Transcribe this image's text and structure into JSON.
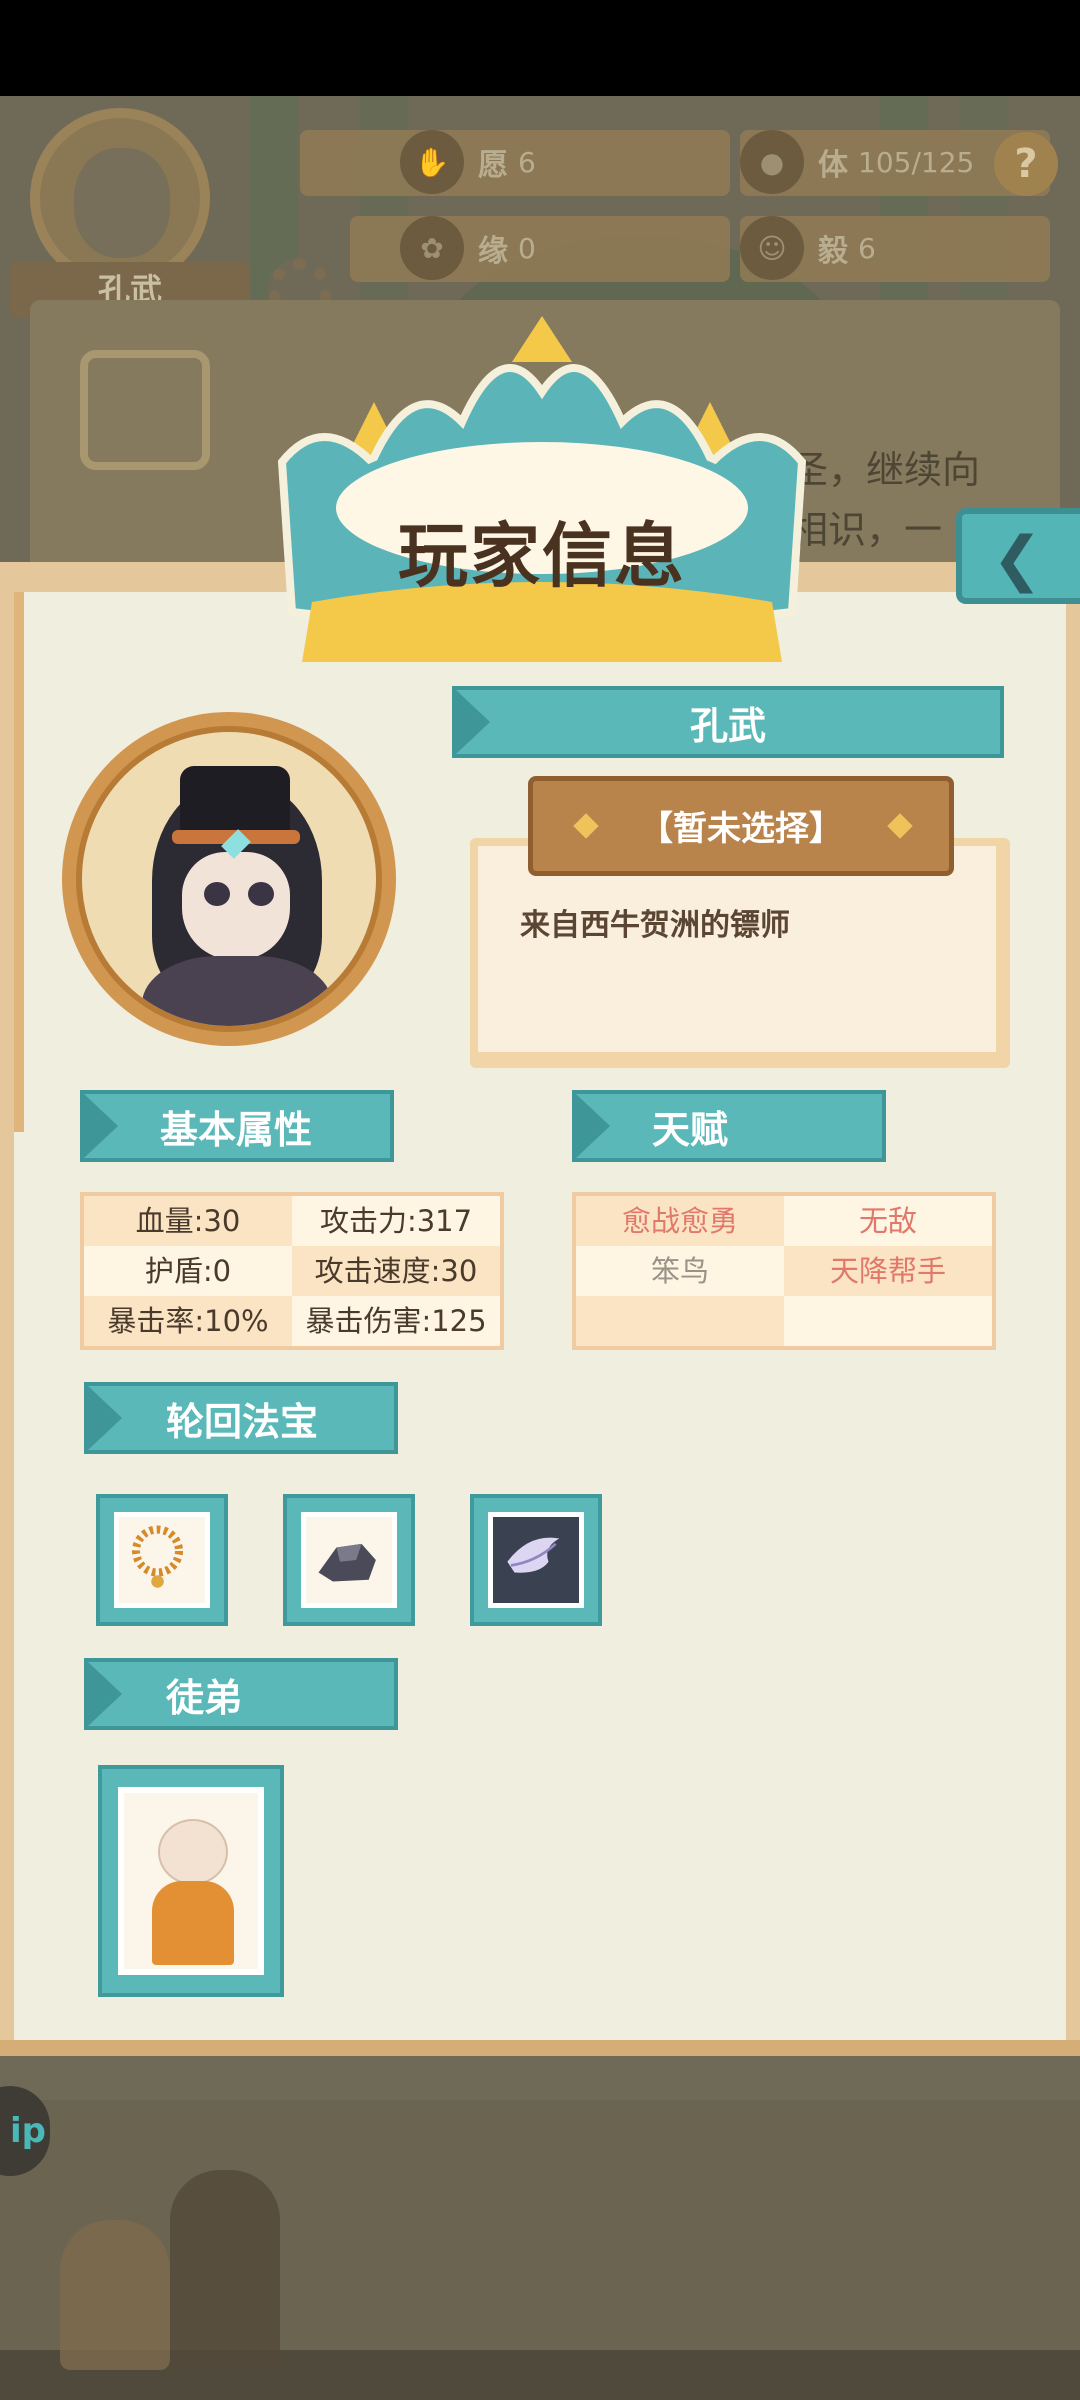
{
  "hud": {
    "player_name": "孔武",
    "stats": [
      {
        "key": "愿",
        "value": "6",
        "icon": "hand-icon"
      },
      {
        "key": "体",
        "value": "105/125",
        "icon": "bun-icon"
      },
      {
        "key": "缘",
        "value": "0",
        "icon": "lotus-icon"
      },
      {
        "key": "毅",
        "value": "6",
        "icon": "face-icon"
      }
    ],
    "help": "?"
  },
  "background_text": [
    "圣，继续向",
    "相识，一"
  ],
  "panel": {
    "title": "玩家信息",
    "back_icon": "chevron-left-icon",
    "name": "孔武",
    "title_select": "【暂未选择】",
    "description": "来自西牛贺洲的镖师",
    "sections": {
      "basic": "基本属性",
      "talent": "天赋",
      "treasure": "轮回法宝",
      "disciple": "徒弟"
    },
    "basic_stats": [
      [
        "血量:30",
        "攻击力:317"
      ],
      [
        "护盾:0",
        "攻击速度:30"
      ],
      [
        "暴击率:10%",
        "暴击伤害:125"
      ]
    ],
    "talents": [
      [
        "愈战愈勇",
        "无敌"
      ],
      [
        "笨鸟",
        "天降帮手"
      ],
      [
        "",
        ""
      ]
    ],
    "treasures": [
      "prayer-beads-icon",
      "ore-stone-icon",
      "feather-scroll-icon"
    ],
    "disciples": [
      "monk-disciple"
    ]
  },
  "side_button": "ip",
  "colors": {
    "teal": "#5bb8b8",
    "panel_bg": "#f0eedf",
    "wood": "#b9834c",
    "talent_red": "#e0796b"
  }
}
